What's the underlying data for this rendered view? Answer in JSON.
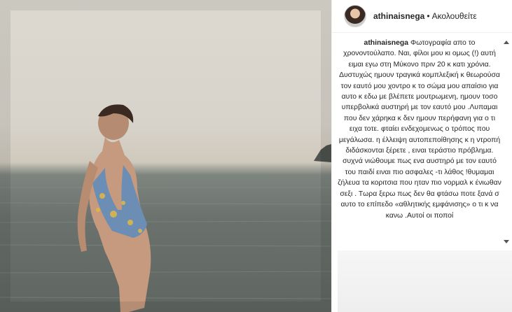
{
  "post": {
    "photo_alt": "photo",
    "header": {
      "username": "athinaisnega",
      "separator": "•",
      "follow_label": "Ακολουθείτε"
    },
    "caption": {
      "username": "athinaisnega",
      "text": "Φωτογραφία απο το χρονοντούλαπο. Ναι, φίλοι μου κι ομως (!) αυτή ειμαι εγω στη Μύκονο πριν 20 κ κατι χρόνια. Δυστυχώς ημουν τραγικά κομπλεξική κ θεωρούσα τον εαυτό μου χοντρο κ το σώμα μου απαίσιο για αυτο κ εδω με βλέπετε μουτρωμενη, ημουν τοσο υπερβολικά αυστηρή με τον εαυτό μου .Λυπαμαι που δεν χάρηκα κ δεν ημουν περήφανη για ο τι ειχα τοτε. φταίει ενδεχομενως ο τρόπος που μεγάλωσα. η έλλειψη αυτοπεποίθησης κ η ντροπή διδάσκονται ξέρετε , ειναι τεράστιο πρόβλημα. συχνά νιώθουμε πως ενα αυστηρό με τον εαυτό του παιδί ειναι πιο ασφαλες -τι λάθος !θυμαμαι ζήλευα τα κοριτσια που ηταν πιο νορμαλ κ ένιωθαν σεξι . Τωρα ξερω πως δεν θα φτάσω ποτε ξανά σ αυτο το επίπεδο «αθλητικής εμφάνισης» ο τι κ να κανω .Αυτοί οι ποποί"
    }
  }
}
